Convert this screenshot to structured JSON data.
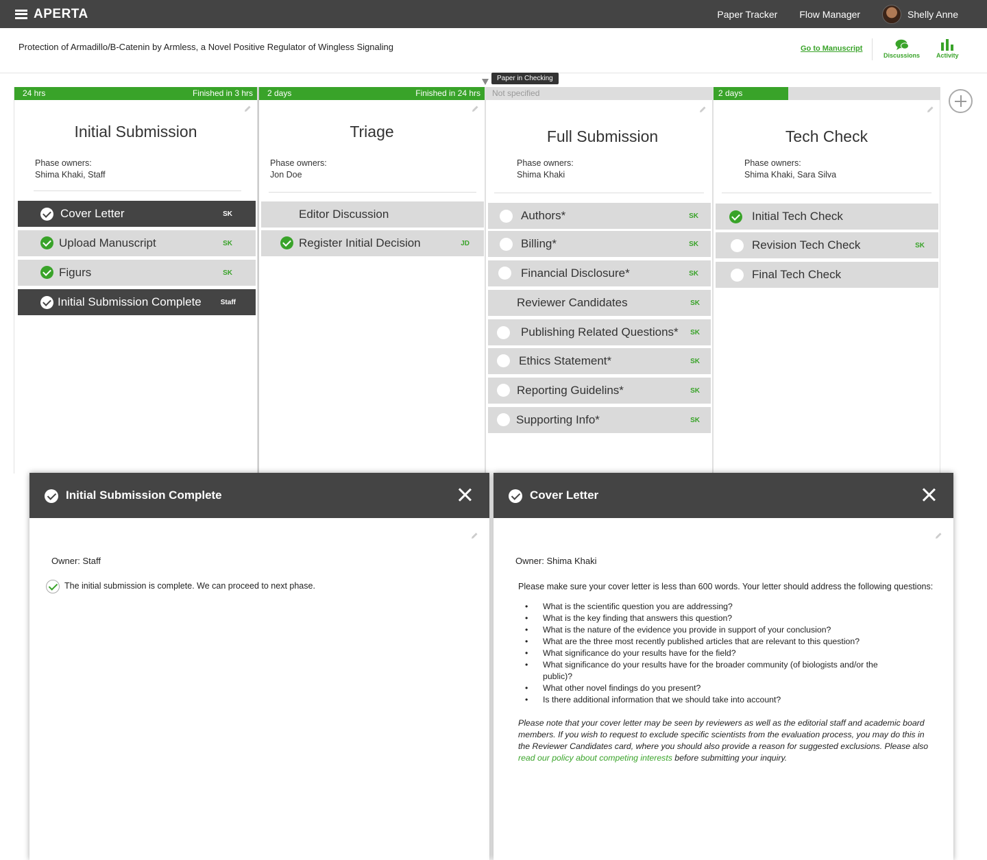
{
  "app": {
    "brand": "APERTA"
  },
  "nav": {
    "paper_tracker": "Paper Tracker",
    "flow_manager": "Flow Manager",
    "user_name": "Shelly Anne"
  },
  "paper": {
    "title": "Protection of Armadillo/B-Catenin by Armless, a Novel Positive Regulator of Wingless Signaling"
  },
  "toolbar": {
    "go_to_manuscript": "Go to Manuscript",
    "discussions": "Discussions",
    "activity": "Activity"
  },
  "status_tooltip": "Paper in Checking",
  "colors": {
    "accent": "#39a329",
    "dark": "#444444",
    "card": "#dadada"
  },
  "phases": [
    {
      "time_left": "24 hrs",
      "time_right": "Finished in 3 hrs",
      "progress": 1.0,
      "name": "Initial Submission",
      "owners_label": "Phase owners:",
      "owners": "Shima Khaki, Staff",
      "cards": [
        {
          "title": "Cover Letter",
          "owner": "SK",
          "state": "done",
          "selected": true
        },
        {
          "title": "Upload Manuscript",
          "owner": "SK",
          "state": "done",
          "selected": false
        },
        {
          "title": "Figurs",
          "owner": "SK",
          "state": "done",
          "selected": false
        },
        {
          "title": "Initial Submission Complete",
          "owner": "Staff",
          "state": "done",
          "selected": true
        }
      ]
    },
    {
      "time_left": "2 days",
      "time_right": "Finished in 24 hrs",
      "progress": 1.0,
      "name": "Triage",
      "owners_label": "Phase owners:",
      "owners": "Jon Doe",
      "cards": [
        {
          "title": "Editor Discussion",
          "owner": "",
          "state": "none",
          "selected": false
        },
        {
          "title": "Register Initial Decision",
          "owner": "JD",
          "state": "done",
          "selected": false
        }
      ]
    },
    {
      "time_left": "Not specified",
      "time_right": "",
      "progress": 0,
      "name": "Full Submission",
      "owners_label": "Phase owners:",
      "owners": "Shima Khaki",
      "cards": [
        {
          "title": "Authors*",
          "owner": "SK",
          "state": "empty",
          "selected": false
        },
        {
          "title": "Billing*",
          "owner": "SK",
          "state": "empty",
          "selected": false
        },
        {
          "title": "Financial Disclosure*",
          "owner": "SK",
          "state": "empty",
          "selected": false
        },
        {
          "title": "Reviewer Candidates",
          "owner": "SK",
          "state": "none",
          "selected": false
        },
        {
          "title": "Publishing Related Questions*",
          "owner": "SK",
          "state": "empty",
          "selected": false
        },
        {
          "title": "Ethics Statement*",
          "owner": "SK",
          "state": "empty",
          "selected": false
        },
        {
          "title": "Reporting Guidelins*",
          "owner": "SK",
          "state": "empty",
          "selected": false
        },
        {
          "title": "Supporting Info*",
          "owner": "SK",
          "state": "empty",
          "selected": false
        }
      ]
    },
    {
      "time_left": "2 days",
      "time_right": "",
      "progress": 0.33,
      "name": "Tech Check",
      "owners_label": "Phase owners:",
      "owners": "Shima Khaki, Sara Silva",
      "cards": [
        {
          "title": "Initial Tech Check",
          "owner": "",
          "state": "done",
          "selected": false
        },
        {
          "title": "Revision Tech Check",
          "owner": "SK",
          "state": "empty",
          "selected": false
        },
        {
          "title": "Final Tech Check",
          "owner": "",
          "state": "empty",
          "selected": false
        }
      ]
    }
  ],
  "overlay_left": {
    "title": "Initial Submission Complete",
    "owner": "Owner: Staff",
    "check_text": "The initial submission is complete. We can proceed to next phase."
  },
  "overlay_right": {
    "title": "Cover Letter",
    "owner": "Owner: Shima Khaki",
    "intro": "Please make sure your cover letter is less than 600 words. Your letter should address the following questions:",
    "questions": [
      "What is the scientific question you are addressing?",
      "What is the key finding that answers this question?",
      "What is the nature of the evidence you provide in support of your conclusion?",
      "What are the three most recently published articles that are relevant to this question?",
      "What significance do your results have for the field?",
      "What significance do your results have for the broader community (of biologists and/or the public)?",
      "What other novel findings do you present?",
      "Is there additional information that we should take into account?"
    ],
    "note_before": "Please note that your cover letter may be seen by reviewers as well as the editorial staff and academic board members. If you wish to request to exclude specific scientists from the evaluation process, you may do this in the Reviewer Candidates card, where you should also provide a reason for suggested exclusions. Please also ",
    "note_link": "read our policy about competing interests",
    "note_after": " before submitting your inquiry."
  }
}
